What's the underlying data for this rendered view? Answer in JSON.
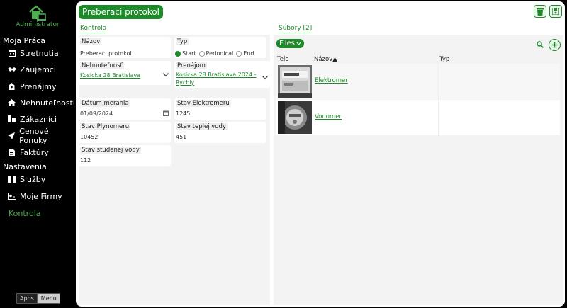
{
  "sidebar": {
    "logo_text": "Administrator",
    "section1": "Moja Práca",
    "section2": "Nastavenia",
    "items": [
      {
        "label": "Stretnutia",
        "icon": "calendar-icon"
      },
      {
        "label": "Záujemci",
        "icon": "handshake-icon"
      },
      {
        "label": "Prenájmy",
        "icon": "house-user-icon"
      },
      {
        "label": "Nehnuteľnosti",
        "icon": "home-icon"
      },
      {
        "label": "Zákazníci",
        "icon": "customers-icon"
      },
      {
        "label": "Cenové Ponuky",
        "icon": "send-icon"
      },
      {
        "label": "Faktúry",
        "icon": "invoice-icon"
      }
    ],
    "settings_items": [
      {
        "label": "Služby",
        "icon": "boxes-icon"
      },
      {
        "label": "Moje Firmy",
        "icon": "id-card-icon"
      }
    ],
    "active_item": "Kontrola",
    "bottom": {
      "apps": "Apps",
      "menu": "Menu"
    }
  },
  "header": {
    "title": "Preberaci protokol"
  },
  "left_tab": "Kontrola",
  "right_tab": "Súbory [2]",
  "form": {
    "nazov": {
      "label": "Názov",
      "value": "Preberaci protokol"
    },
    "typ": {
      "label": "Typ",
      "options": [
        "Start",
        "Periodical",
        "End"
      ],
      "selected": "Start"
    },
    "nehnutelnost": {
      "label": "Nehnuteľnosť",
      "value": "Kosicka 28 Bratislava"
    },
    "prenajom": {
      "label": "Prenájom",
      "value_line1": "Kosicka 28 Bratislava 2024 -",
      "value_line2": "Rychly"
    },
    "datum": {
      "label": "Dátum merania",
      "value": "01/09/2024"
    },
    "elektromer": {
      "label": "Stav Elektromeru",
      "value": "1245"
    },
    "plynomer": {
      "label": "Stav Plynomeru",
      "value": "10452"
    },
    "tepla_voda": {
      "label": "Stav teplej vody",
      "value": "451"
    },
    "studena_voda": {
      "label": "Stav studenej vody",
      "value": "112"
    }
  },
  "files": {
    "button": "Files",
    "columns": {
      "telo": "Telo",
      "nazov": "Názov▲",
      "typ": "Typ"
    },
    "rows": [
      {
        "name": "Elektromer"
      },
      {
        "name": "Vodomer"
      }
    ]
  },
  "colors": {
    "accent": "#1e8a2a",
    "sidebar_bg": "#000000"
  }
}
